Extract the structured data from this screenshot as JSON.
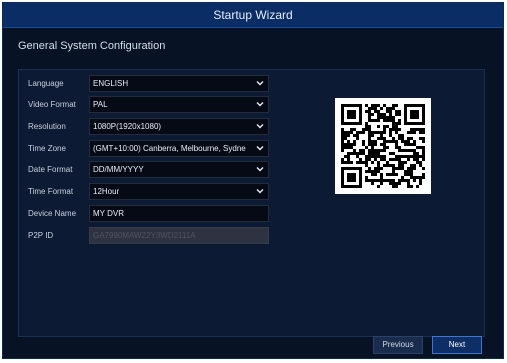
{
  "window": {
    "title": "Startup Wizard"
  },
  "section": {
    "title": "General System Configuration"
  },
  "form": {
    "language": {
      "label": "Language",
      "value": "ENGLISH"
    },
    "video_format": {
      "label": "Video Format",
      "value": "PAL"
    },
    "resolution": {
      "label": "Resolution",
      "value": "1080P(1920x1080)"
    },
    "time_zone": {
      "label": "Time Zone",
      "value": "(GMT+10:00) Canberra, Melbourne, Sydne"
    },
    "date_format": {
      "label": "Date Format",
      "value": "DD/MM/YYYY"
    },
    "time_format": {
      "label": "Time Format",
      "value": "12Hour"
    },
    "device_name": {
      "label": "Device Name",
      "value": "MY DVR"
    },
    "p2p_id": {
      "label": "P2P ID",
      "value": "GA7990MAW22Y3WD2111A"
    }
  },
  "footer": {
    "previous_label": "Previous",
    "next_label": "Next"
  },
  "colors": {
    "title_bar": "#0b2d66",
    "background": "#071224",
    "panel": "#0c1a33",
    "accent": "#3f75cf"
  },
  "icons": {
    "dropdown": "chevron-down-icon",
    "qr": "qr-code-icon"
  }
}
